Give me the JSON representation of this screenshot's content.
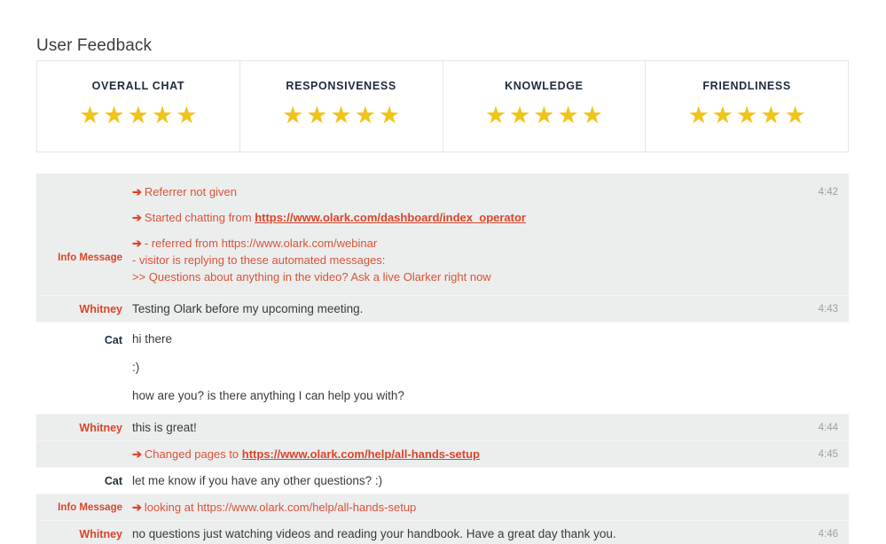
{
  "page": {
    "title": "User Feedback"
  },
  "ratings": {
    "max_stars": 5,
    "star_glyph": "★",
    "star_color": "#f0c419",
    "cards": [
      {
        "label": "OVERALL CHAT",
        "stars": 5
      },
      {
        "label": "RESPONSIVENESS",
        "stars": 5
      },
      {
        "label": "KNOWLEDGE",
        "stars": 5
      },
      {
        "label": "FRIENDLINESS",
        "stars": 5
      }
    ]
  },
  "transcript": {
    "arrow_glyph": "➔",
    "labels": {
      "info": "Info Message",
      "visitor": "Whitney",
      "operator": "Cat"
    },
    "rows": [
      {
        "speaker": "Info Message",
        "speaker_type": "info",
        "time": "4:42",
        "lines": [
          {
            "arrow": true,
            "text": "Referrer not given"
          },
          {
            "arrow": true,
            "text": "Started chatting from ",
            "link": "https://www.olark.com/dashboard/index_operator"
          },
          {
            "arrow": true,
            "text": "- referred from https://www.olark.com/webinar"
          },
          {
            "arrow": false,
            "text": "- visitor is replying to these automated messages:"
          },
          {
            "arrow": false,
            "text": ">> Questions about anything in the video? Ask a live Olarker right now"
          }
        ]
      },
      {
        "speaker": "Whitney",
        "speaker_type": "visitor",
        "time": "4:43",
        "lines": [
          {
            "arrow": false,
            "text": "Testing Olark before my upcoming meeting."
          }
        ]
      },
      {
        "speaker": "Cat",
        "speaker_type": "operator",
        "time": "",
        "lines": [
          {
            "arrow": false,
            "text": "hi there"
          },
          {
            "arrow": false,
            "text": ":)"
          },
          {
            "arrow": false,
            "text": "how are you? is there anything I can help you with?"
          }
        ]
      },
      {
        "speaker": "Whitney",
        "speaker_type": "visitor",
        "time": "4:44",
        "lines": [
          {
            "arrow": false,
            "text": "this is great!"
          }
        ]
      },
      {
        "speaker": "",
        "speaker_type": "visitor",
        "time": "4:45",
        "lines": [
          {
            "arrow": true,
            "text": "Changed pages to ",
            "link": "https://www.olark.com/help/all-hands-setup"
          }
        ]
      },
      {
        "speaker": "Cat",
        "speaker_type": "operator",
        "time": "",
        "lines": [
          {
            "arrow": false,
            "text": "let me know if you have any other questions? :)"
          }
        ]
      },
      {
        "speaker": "Info Message",
        "speaker_type": "info",
        "time": "",
        "lines": [
          {
            "arrow": true,
            "text": "looking at https://www.olark.com/help/all-hands-setup"
          }
        ]
      },
      {
        "speaker": "Whitney",
        "speaker_type": "visitor",
        "time": "4:46",
        "lines": [
          {
            "arrow": false,
            "text": "no questions just watching videos and reading your handbook. Have a great day thank you."
          }
        ]
      }
    ]
  }
}
